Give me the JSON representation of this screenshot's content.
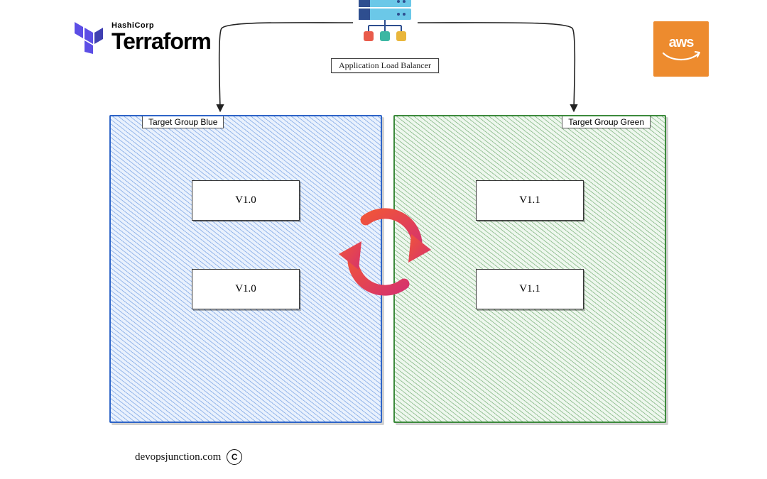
{
  "logos": {
    "terraform_sub": "HashiCorp",
    "terraform_main": "Terraform",
    "aws": "aws"
  },
  "alb": {
    "label": "Application Load Balancer"
  },
  "groups": {
    "blue": {
      "label": "Target Group Blue",
      "boxes": [
        "V1.0",
        "V1.0"
      ]
    },
    "green": {
      "label": "Target Group  Green",
      "boxes": [
        "V1.1",
        "V1.1"
      ]
    }
  },
  "footer": {
    "site": "devopsjunction.com",
    "mark": "C"
  },
  "colors": {
    "blue": "#4A80D4",
    "green": "#4E9A4E",
    "aws": "#ED8B2E",
    "tf": "#5C4EE5",
    "sync_a": "#F0543A",
    "sync_b": "#D6336C"
  }
}
